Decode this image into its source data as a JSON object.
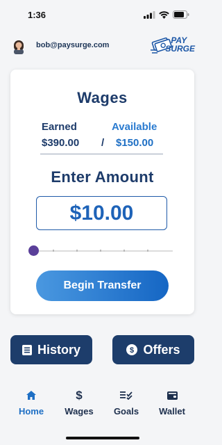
{
  "status_bar": {
    "time": "1:36"
  },
  "header": {
    "email": "bob@paysurge.com",
    "logo_line1": "PAY",
    "logo_line2": "SURGE"
  },
  "card": {
    "title": "Wages",
    "earned_label": "Earned",
    "available_label": "Available",
    "earned_value": "$390.00",
    "separator": "/",
    "available_value": "$150.00",
    "enter_label": "Enter Amount",
    "amount": "$10.00",
    "slider_fraction": 0.0,
    "begin_button": "Begin Transfer"
  },
  "actions": {
    "history": "History",
    "offers": "Offers"
  },
  "tabs": [
    {
      "label": "Home",
      "icon": "home-icon",
      "active": true
    },
    {
      "label": "Wages",
      "icon": "dollar-icon",
      "active": false
    },
    {
      "label": "Goals",
      "icon": "goals-icon",
      "active": false
    },
    {
      "label": "Wallet",
      "icon": "wallet-icon",
      "active": false
    }
  ],
  "colors": {
    "accent": "#1e6fc4",
    "navy": "#1d3d6b",
    "slider_thumb": "#5a3f99"
  }
}
